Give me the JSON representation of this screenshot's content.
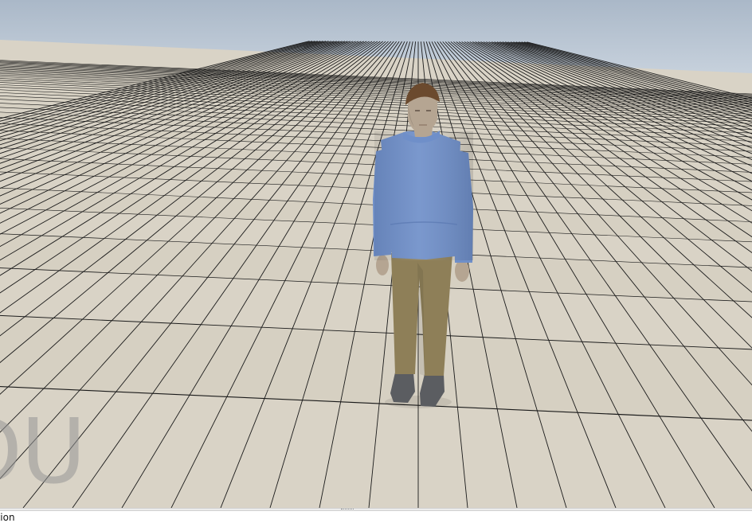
{
  "viewport": {
    "watermark_text": "DU",
    "sky_top_color": "#aab8c8",
    "sky_bottom_color": "#c9d3de",
    "floor_color": "#d9d3c6",
    "grid_line_color": "#1a1a1a",
    "character": {
      "shirt_color": "#6f8fc9",
      "pants_color": "#8e7f58",
      "skin_color": "#b5a592",
      "hair_color": "#6b4a2e",
      "shoe_color": "#5b5d61"
    }
  },
  "status_bar": {
    "text": "ction"
  }
}
